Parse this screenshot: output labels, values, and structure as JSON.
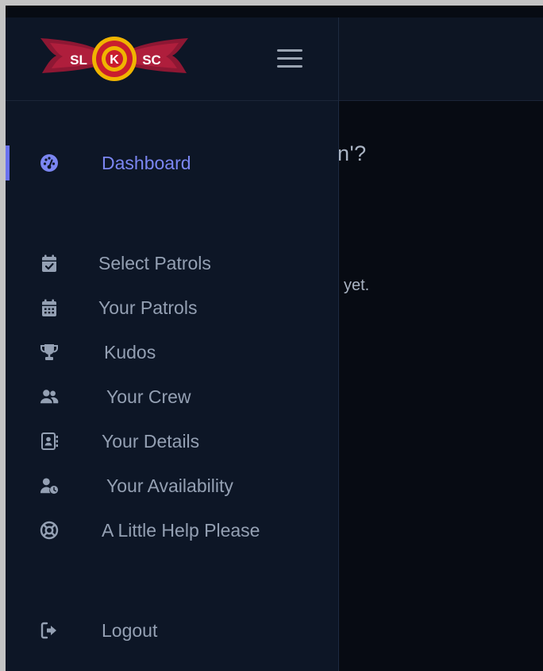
{
  "logo": {
    "left_text": "SL",
    "center_text": "K",
    "right_text": "SC"
  },
  "background": {
    "heading_fragment": "n'?",
    "body_fragment": "yet."
  },
  "sidebar": {
    "items": [
      {
        "label": "Dashboard",
        "icon": "dashboard-gauge-icon",
        "active": true
      },
      {
        "label": "Select Patrols",
        "icon": "calendar-check-icon",
        "active": false
      },
      {
        "label": "Your Patrols",
        "icon": "calendar-grid-icon",
        "active": false
      },
      {
        "label": "Kudos",
        "icon": "trophy-icon",
        "active": false
      },
      {
        "label": "Your Crew",
        "icon": "users-icon",
        "active": false
      },
      {
        "label": "Your Details",
        "icon": "address-book-icon",
        "active": false
      },
      {
        "label": "Your Availability",
        "icon": "user-clock-icon",
        "active": false
      },
      {
        "label": "A Little Help Please",
        "icon": "life-ring-icon",
        "active": false
      }
    ],
    "logout": {
      "label": "Logout",
      "icon": "logout-icon"
    }
  },
  "colors": {
    "sidebar_bg": "#0d1626",
    "page_bg": "#070b13",
    "accent": "#6a72f0",
    "nav_text": "#94a0b3",
    "active_text": "#7b86f2",
    "logo_wing": "#8e1733",
    "logo_ring": "#f0b400"
  }
}
